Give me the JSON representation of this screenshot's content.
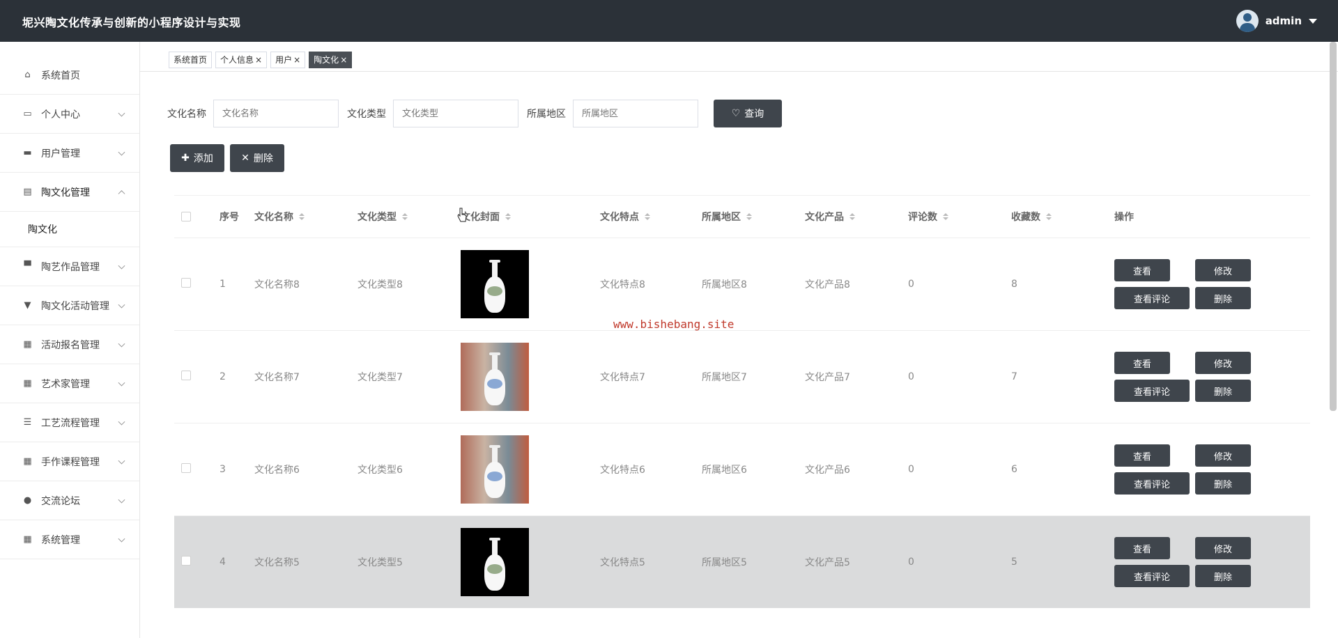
{
  "app": {
    "title": "坭兴陶文化传承与创新的小程序设计与实现"
  },
  "user": {
    "name": "admin",
    "avatar_icon": "user-avatar-icon"
  },
  "sidebar": {
    "items": [
      {
        "label": "系统首页",
        "icon": "home-icon"
      },
      {
        "label": "个人中心",
        "icon": "card-icon"
      },
      {
        "label": "用户管理",
        "icon": "monitor-icon"
      },
      {
        "label": "陶文化管理",
        "icon": "clipboard-icon"
      },
      {
        "label": "陶艺作品管理",
        "icon": "printer-icon"
      },
      {
        "label": "陶文化活动管理",
        "icon": "flag-icon"
      },
      {
        "label": "活动报名管理",
        "icon": "grid-icon"
      },
      {
        "label": "艺术家管理",
        "icon": "grid-icon"
      },
      {
        "label": "工艺流程管理",
        "icon": "list-icon"
      },
      {
        "label": "手作课程管理",
        "icon": "grid-icon"
      },
      {
        "label": "交流论坛",
        "icon": "bulb-icon"
      },
      {
        "label": "系统管理",
        "icon": "grid-icon"
      }
    ],
    "sub_item": "陶文化"
  },
  "tabs": [
    {
      "label": "系统首页",
      "closable": false
    },
    {
      "label": "个人信息",
      "closable": true
    },
    {
      "label": "用户",
      "closable": true
    },
    {
      "label": "陶文化",
      "closable": true,
      "active": true
    }
  ],
  "search": {
    "name_label": "文化名称",
    "name_placeholder": "文化名称",
    "type_label": "文化类型",
    "type_placeholder": "文化类型",
    "region_label": "所属地区",
    "region_placeholder": "所属地区",
    "query_button": "查询"
  },
  "actions": {
    "add": "添加",
    "delete": "删除"
  },
  "table": {
    "headers": [
      "序号",
      "文化名称",
      "文化类型",
      "文化封面",
      "文化特点",
      "所属地区",
      "文化产品",
      "评论数",
      "收藏数",
      "操作"
    ],
    "rows": [
      {
        "index": "1",
        "name": "文化名称8",
        "type": "文化类型8",
        "feature": "文化特点8",
        "region": "所属地区8",
        "product": "文化产品8",
        "comments": "0",
        "favorites": "8"
      },
      {
        "index": "2",
        "name": "文化名称7",
        "type": "文化类型7",
        "feature": "文化特点7",
        "region": "所属地区7",
        "product": "文化产品7",
        "comments": "0",
        "favorites": "7"
      },
      {
        "index": "3",
        "name": "文化名称6",
        "type": "文化类型6",
        "feature": "文化特点6",
        "region": "所属地区6",
        "product": "文化产品6",
        "comments": "0",
        "favorites": "6"
      },
      {
        "index": "4",
        "name": "文化名称5",
        "type": "文化类型5",
        "feature": "文化特点5",
        "region": "所属地区5",
        "product": "文化产品5",
        "comments": "0",
        "favorites": "5"
      }
    ],
    "row_buttons": {
      "view": "查看",
      "edit": "修改",
      "view_comments": "查看评论",
      "delete": "删除"
    }
  },
  "watermark": "www.bishebang.site",
  "colors": {
    "topbar": "#2b3138",
    "button": "#3f454c",
    "highlight_row": "#dadbdc",
    "watermark": "#c0392b"
  }
}
